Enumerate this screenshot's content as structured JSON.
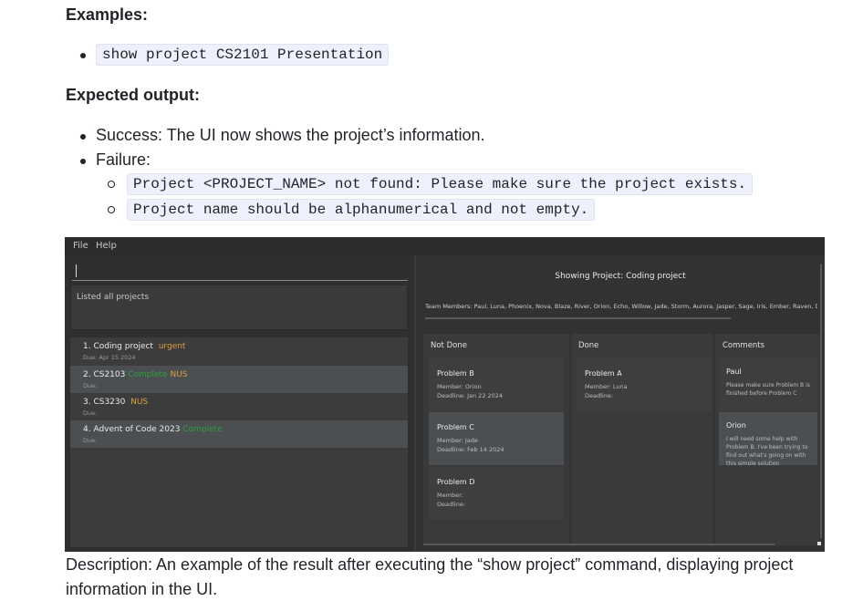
{
  "examples": {
    "heading": "Examples:",
    "items": [
      "show project CS2101 Presentation"
    ]
  },
  "expected": {
    "heading": "Expected output:",
    "success": "Success: The UI now shows the project’s information.",
    "failure": "Failure:",
    "failure_messages": [
      "Project <PROJECT_NAME> not found: Please make sure the project exists.",
      "Project name should be alphanumerical and not empty."
    ]
  },
  "app": {
    "menu": [
      "File",
      "Help"
    ],
    "result_text": "Listed all projects",
    "projects": [
      {
        "name": "1.  Coding project",
        "tags": [
          {
            "text": "urgent",
            "kind": "urgent"
          }
        ],
        "due": "Due: Apr 15 2024"
      },
      {
        "name": "2.  CS2103",
        "tags": [
          {
            "text": "Complete",
            "kind": "green"
          },
          {
            "text": "NUS",
            "kind": "nus"
          }
        ],
        "due": "Due:"
      },
      {
        "name": "3.  CS3230",
        "tags": [
          {
            "text": "NUS",
            "kind": "nus"
          }
        ],
        "due": "Due:"
      },
      {
        "name": "4.  Advent of Code 2023",
        "tags": [
          {
            "text": "Complete",
            "kind": "green"
          }
        ],
        "due": "Due:"
      }
    ],
    "showing_title": "Showing Project: Coding project",
    "team_members": "Team Members: Paul, Luna, Phoenix, Nova, Blaze, River, Orion, Echo, Willow, Jade, Storm, Aurora, Jasper, Sage, Iris, Ember, Raven, Dawn, Zephyr",
    "columns": {
      "not_done": {
        "heading": "Not Done",
        "cards": [
          {
            "title": "Problem B",
            "member": "Member: Orion",
            "deadline": "Deadline: Jan 22 2024"
          },
          {
            "title": "Problem C",
            "member": "Member: Jade",
            "deadline": "Deadline: Feb 14 2024"
          },
          {
            "title": "Problem D",
            "member": "Member:",
            "deadline": "Deadline:"
          }
        ]
      },
      "done": {
        "heading": "Done",
        "cards": [
          {
            "title": "Problem A",
            "member": "Member: Luna",
            "deadline": "Deadline:"
          }
        ]
      },
      "comments": {
        "heading": "Comments",
        "cards": [
          {
            "author": "Paul",
            "body": "Please make sure Problem B is finished before Problem C"
          },
          {
            "author": "Orion",
            "body": "I will need some help with Problem B. I've been trying to find out what's going on with this simple solution"
          }
        ]
      }
    },
    "colors": {
      "background": "#3b3b3b",
      "urgent": "#e09a3c",
      "nus": "#e0a040",
      "complete": "#2e9e3c"
    }
  },
  "description": "Description: An example of the result after executing the “show project” command, displaying project information in the UI."
}
